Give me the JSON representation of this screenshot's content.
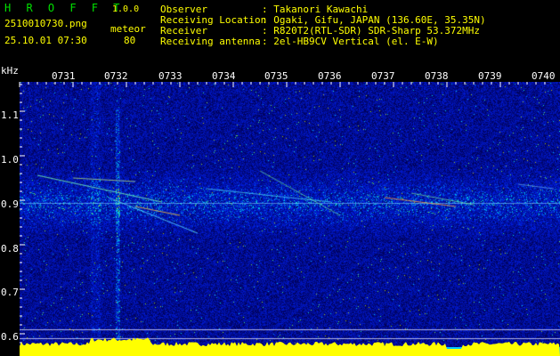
{
  "header": {
    "app_name": "H R O F F T",
    "version": "1.0.0",
    "filename": "2510010730.png",
    "datetime": "25.10.01 07:30",
    "meteor_label": "meteor",
    "meteor_count": "80"
  },
  "info": {
    "rows": [
      {
        "label": "Observer",
        "value": ": Takanori Kawachi"
      },
      {
        "label": "Receiving Location",
        "value": ": Ogaki, Gifu, JAPAN (136.60E, 35.35N)"
      },
      {
        "label": "Receiver",
        "value": ": R820T2(RTL-SDR) SDR-Sharp 53.372MHz"
      },
      {
        "label": "Receiving antenna",
        "value": ": 2el-HB9CV Vertical (el. E-W)"
      }
    ]
  },
  "axis": {
    "y_unit": "kHz",
    "y_ticks": [
      "1.1",
      "1.0",
      "0.9",
      "0.8",
      "0.7",
      "0.6"
    ],
    "time_ticks": [
      "0731",
      "0732",
      "0733",
      "0734",
      "0735",
      "0736",
      "0737",
      "0738",
      "0739",
      "0740"
    ]
  },
  "colors": {
    "background": "#000000",
    "header_yellow": "#ffff00",
    "title_green": "#00e000",
    "spectrogram_base": "#000a6e",
    "power_bar": "#ffff00",
    "power_base": "#00c8ff"
  }
}
